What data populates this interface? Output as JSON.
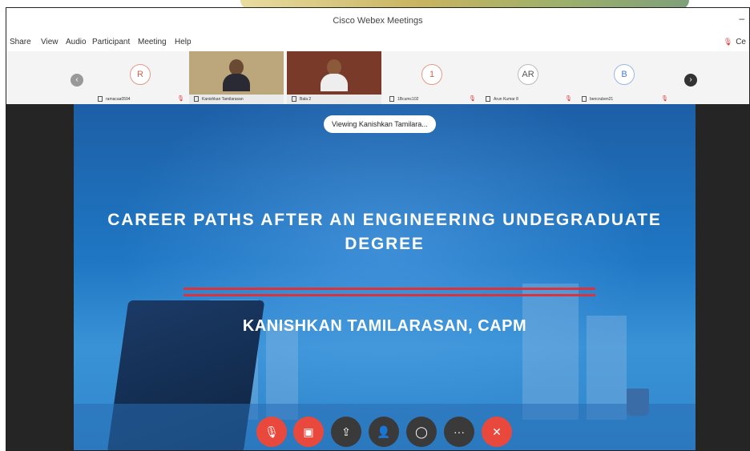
{
  "window": {
    "title": "Cisco Webex Meetings",
    "minimize": "–"
  },
  "menu": {
    "items": [
      "Share",
      "View",
      "Audio",
      "Participant",
      "Meeting",
      "Help"
    ],
    "right_label": "Ce"
  },
  "participants": [
    {
      "initial": "R",
      "name": "ramacaa0594"
    },
    {
      "initial": "",
      "name": "Kanishkan Tamilarasan"
    },
    {
      "initial": "",
      "name": "Bala 2"
    },
    {
      "initial": "1",
      "name": "1Bcumc102"
    },
    {
      "initial": "AR",
      "name": "Arun Kumar 8"
    },
    {
      "initial": "B",
      "name": "bencruben21"
    }
  ],
  "nav": {
    "prev": "‹",
    "next": "›"
  },
  "viewing": "Viewing Kanishkan Tamilara...",
  "slide": {
    "title_line1": "CAREER PATHS AFTER AN ENGINEERING UNDEGRADUATE",
    "title_line2": "DEGREE",
    "presenter": "KANISHKAN TAMILARASAN, CAPM"
  },
  "controls": [
    {
      "name": "mute-button",
      "glyph": "🎙"
    },
    {
      "name": "video-button",
      "glyph": "▣"
    },
    {
      "name": "share-button",
      "glyph": "⇪"
    },
    {
      "name": "participants-button",
      "glyph": "👤"
    },
    {
      "name": "chat-button",
      "glyph": "◯"
    },
    {
      "name": "more-button",
      "glyph": "···"
    },
    {
      "name": "end-call-button",
      "glyph": "✕"
    }
  ],
  "colors": {
    "accent_red": "#e9493d",
    "slide_blue": "#1f77c4",
    "mic_red": "#d33"
  }
}
